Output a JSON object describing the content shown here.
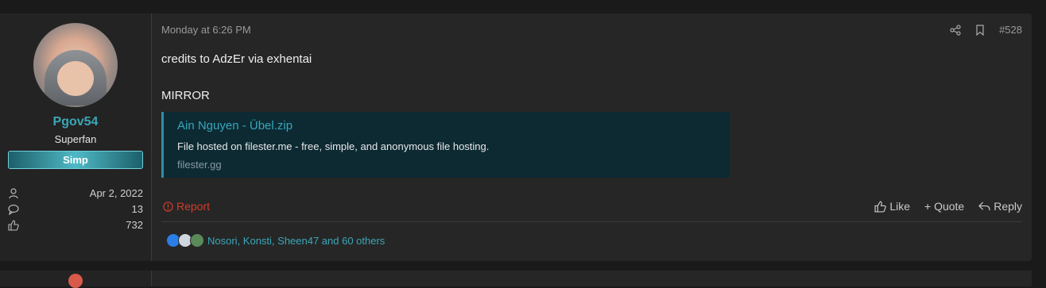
{
  "user": {
    "name": "Pgov54",
    "title": "Superfan",
    "banner": "Simp",
    "joined": "Apr 2, 2022",
    "messages": "13",
    "reactions": "732"
  },
  "post": {
    "date": "Monday at 6:26 PM",
    "number": "#528",
    "lines": [
      "credits to AdzEr via exhentai",
      "MIRROR"
    ],
    "embed": {
      "title": "Ain Nguyen - Übel.zip",
      "description": "File hosted on filester.me - free, simple, and anonymous file hosting.",
      "domain": "filester.gg"
    },
    "report_label": "Report",
    "like_label": "Like",
    "quote_label": "+ Quote",
    "reply_label": "Reply",
    "reactions_text": "Nosori, Konsti, Sheen47 and 60 others"
  },
  "icons": {
    "share": "share-icon",
    "bookmark": "bookmark-icon",
    "joined": "user-icon",
    "messages": "speech-bubble-icon",
    "reactions": "thumbs-up-icon"
  },
  "colors": {
    "accent": "#3aa7b8",
    "report": "#d33b2a",
    "embed_bg": "#0d2a33"
  }
}
